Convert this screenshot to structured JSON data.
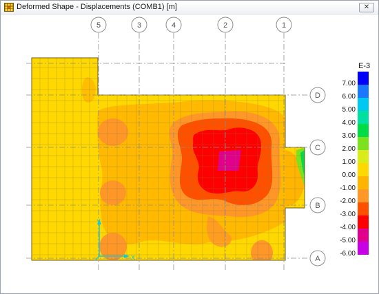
{
  "window": {
    "title": "Deformed Shape - Displacements (COMB1)  [m]",
    "close_symbol": "✕"
  },
  "grid": {
    "vertical_labels": [
      "5",
      "3",
      "4",
      "2",
      "1"
    ],
    "horizontal_labels": [
      "D",
      "C",
      "B",
      "A"
    ]
  },
  "axes": {
    "y_label": "Y",
    "x_label": "X"
  },
  "legend": {
    "title": "E-3",
    "items": [
      {
        "label": "7.00",
        "color": "#0000ff"
      },
      {
        "label": "6.00",
        "color": "#1a78ff"
      },
      {
        "label": "5.00",
        "color": "#00c8f0"
      },
      {
        "label": "4.00",
        "color": "#00e0a0"
      },
      {
        "label": "3.00",
        "color": "#00dc46"
      },
      {
        "label": "2.00",
        "color": "#7ce21e"
      },
      {
        "label": "1.00",
        "color": "#d8ec18"
      },
      {
        "label": "0.00",
        "color": "#ffd800"
      },
      {
        "label": "-1.00",
        "color": "#ffb400"
      },
      {
        "label": "-2.00",
        "color": "#ff9628"
      },
      {
        "label": "-3.00",
        "color": "#ff5000"
      },
      {
        "label": "-4.00",
        "color": "#ff0000"
      },
      {
        "label": "-5.00",
        "color": "#e0008c"
      },
      {
        "label": "-6.00",
        "color": "#c800e6"
      }
    ]
  }
}
